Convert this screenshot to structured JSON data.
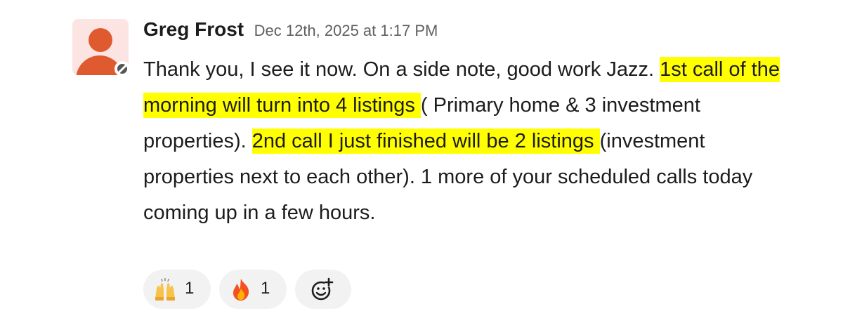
{
  "message": {
    "sender": "Greg Frost",
    "timestamp": "Dec 12th, 2025 at 1:17 PM",
    "body": {
      "part1": "Thank you, I see it now. On a side note, good work Jazz. ",
      "highlight1": "1st call of the morning will turn into 4 listings ",
      "part2": "( Primary home & 3 investment properties). ",
      "highlight2": "2nd call I just finished will be 2 listings ",
      "part3": "(investment properties next to each other). 1 more of your scheduled calls today coming up in a few hours."
    },
    "highlight_color": "#ffff00"
  },
  "reactions": [
    {
      "emoji": "raised-hands-icon",
      "count": "1"
    },
    {
      "emoji": "fire-icon",
      "count": "1"
    }
  ],
  "add_reaction_icon": "add-emoji-icon",
  "avatar_color": "#e05a2f"
}
